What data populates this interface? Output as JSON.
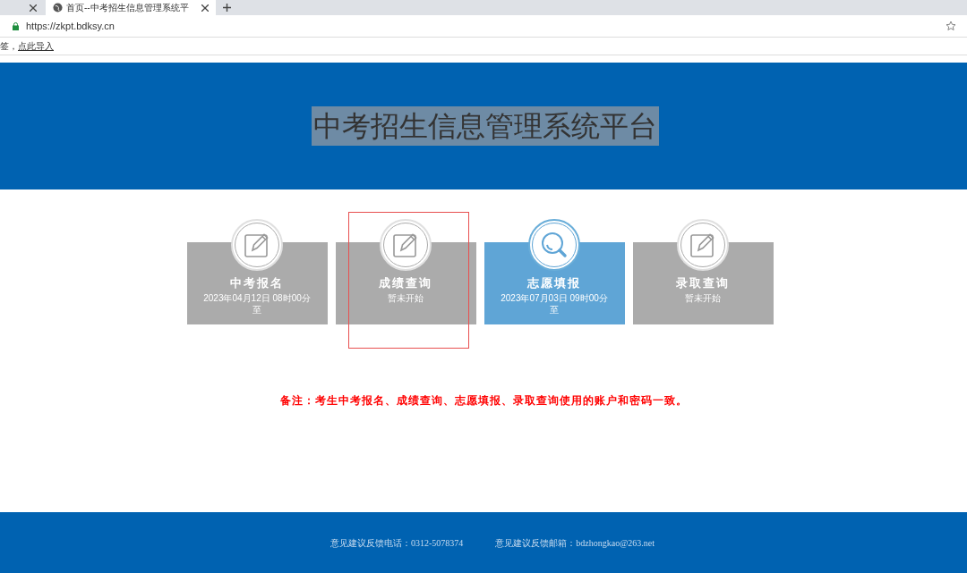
{
  "browser": {
    "tab": {
      "title": "首页--中考招生信息管理系统平",
      "selected": true
    },
    "url": "https://zkpt.bdksy.cn",
    "bookmarks_text": "签，",
    "bookmarks_link": "点此导入"
  },
  "header": {
    "title": "中考招生信息管理系统平台",
    "selected": true
  },
  "cards": [
    {
      "title": "中考报名",
      "kind": "pencil",
      "active": false,
      "highlighted": false,
      "lines": [
        "2023年04月12日 08时00分",
        "至"
      ]
    },
    {
      "title": "成绩查询",
      "kind": "pencil",
      "active": false,
      "highlighted": true,
      "lines": [
        "暂未开始"
      ]
    },
    {
      "title": "志愿填报",
      "kind": "search",
      "active": true,
      "highlighted": false,
      "lines": [
        "2023年07月03日 09时00分",
        "至"
      ]
    },
    {
      "title": "录取查询",
      "kind": "pencil",
      "active": false,
      "highlighted": false,
      "lines": [
        "暂未开始"
      ]
    }
  ],
  "note": "备注：考生中考报名、成绩查询、志愿填报、录取查询使用的账户和密码一致。",
  "footer": [
    "意见建议反馈电话：0312-5078374",
    "意见建议反馈邮箱：bdzhongkao@263.net"
  ]
}
